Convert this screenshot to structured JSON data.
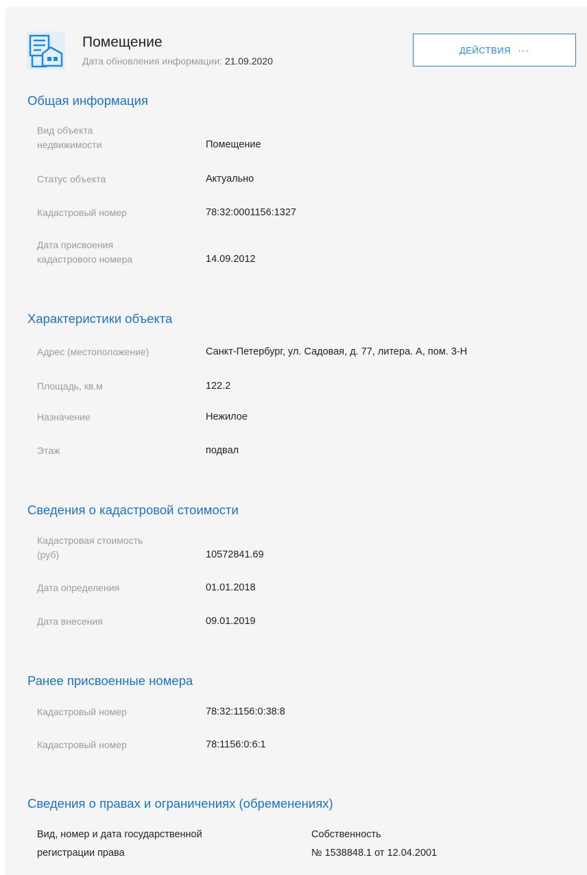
{
  "header": {
    "title": "Помещение",
    "updated_label": "Дата обновления информации:",
    "updated_date": "21.09.2020",
    "actions_label": "ДЕЙСТВИЯ",
    "actions_dots": "···",
    "icon": "building-document-icon",
    "accent_color": "#1e88e5"
  },
  "general": {
    "title": "Общая информация",
    "rows": [
      {
        "label1": "Вид объекта",
        "label2": "недвижимости",
        "value": "Помещение"
      },
      {
        "label": "Статус объекта",
        "value": "Актуально"
      },
      {
        "label": "Кадастровый номер",
        "value": "78:32:0001156:1327"
      },
      {
        "label1": "Дата присвоения",
        "label2": "кадастрового номера",
        "value": "14.09.2012"
      }
    ]
  },
  "characteristics": {
    "title": "Характеристики объекта",
    "rows": [
      {
        "label": "Адрес (местоположение)",
        "value": "Санкт-Петербург, ул. Садовая, д. 77, литера. А, пом. 3-Н"
      },
      {
        "label": "Площадь, кв.м",
        "value": "122.2"
      },
      {
        "label": "Назначение",
        "value": "Нежилое"
      },
      {
        "label": "Этаж",
        "value": "подвал"
      }
    ]
  },
  "cost": {
    "title": "Сведения о кадастровой стоимости",
    "rows": [
      {
        "label1": "Кадастровая стоимость",
        "label2": "(руб)",
        "value": "10572841.69"
      },
      {
        "label": "Дата определения",
        "value": "01.01.2018"
      },
      {
        "label": "Дата внесения",
        "value": "09.01.2019"
      }
    ]
  },
  "previous": {
    "title": "Ранее присвоенные номера",
    "rows": [
      {
        "label": "Кадастровый номер",
        "value": "78:32:1156:0:38:8"
      },
      {
        "label": "Кадастровый номер",
        "value": "78:1156:0:6:1"
      }
    ]
  },
  "rights": {
    "title": "Сведения о правах и ограничениях (обременениях)",
    "label1": "Вид, номер и дата государственной",
    "label2": "регистрации права",
    "value1": "Собственность",
    "value2": "№ 1538848.1 от 12.04.2001"
  }
}
